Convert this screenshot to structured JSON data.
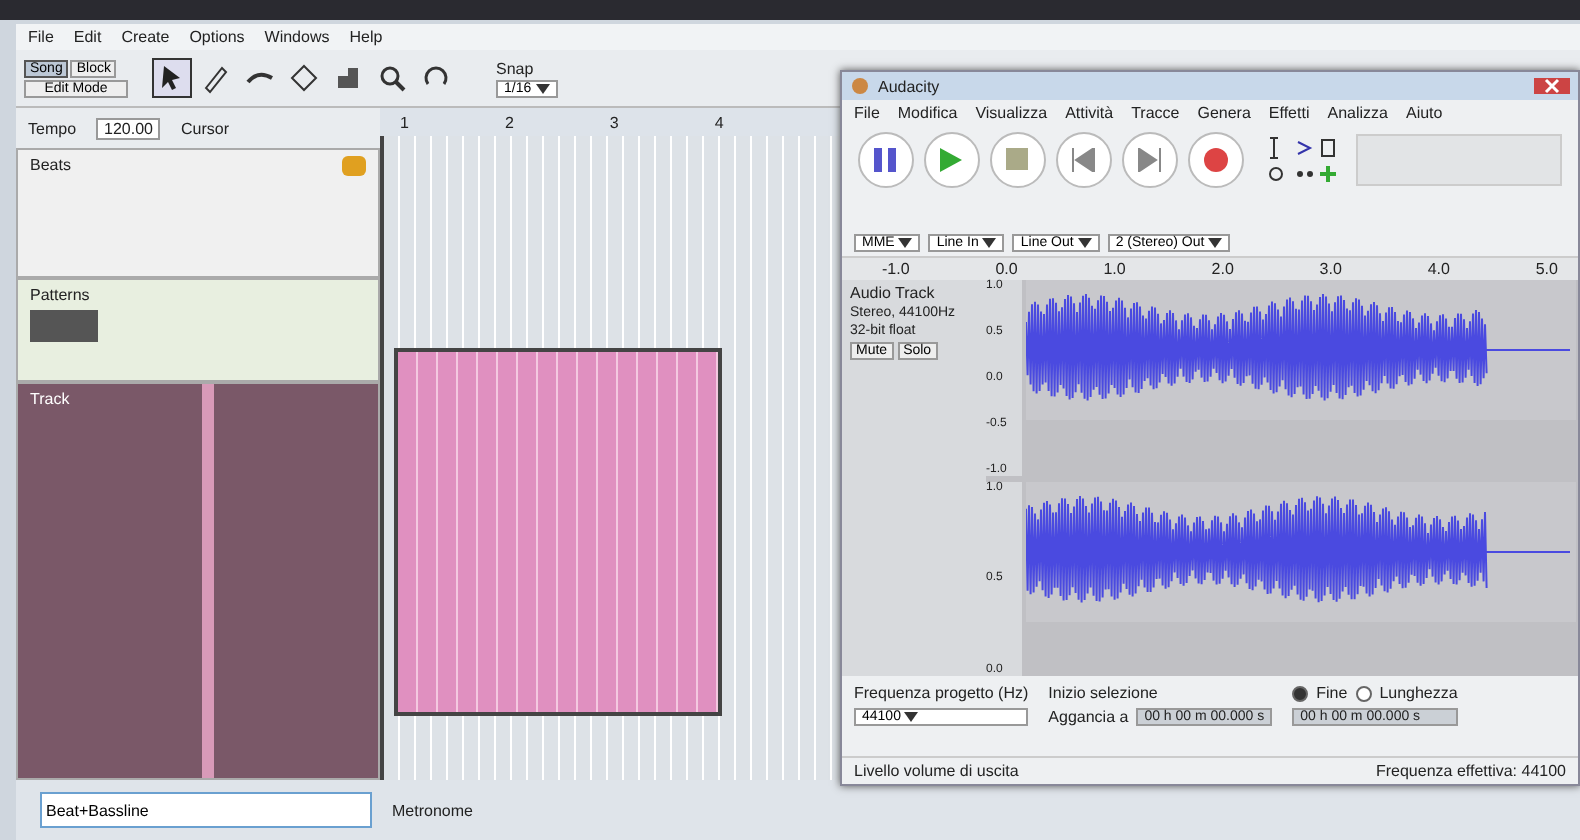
{
  "back_window": {
    "menu": [
      "File",
      "Edit",
      "Create",
      "Options",
      "Windows",
      "Help"
    ],
    "mode_buttons": [
      {
        "label": "Song",
        "selected": true
      },
      {
        "label": "Block",
        "selected": false
      }
    ],
    "edit_mode": "Edit Mode",
    "tools": [
      {
        "kind": "pointer",
        "selected": true
      },
      {
        "kind": "pencil",
        "selected": false
      },
      {
        "kind": "eraser",
        "selected": false
      },
      {
        "kind": "split",
        "selected": false
      },
      {
        "kind": "glue",
        "selected": false
      },
      {
        "kind": "zoom",
        "selected": false
      },
      {
        "kind": "loop",
        "selected": false
      }
    ],
    "snap": {
      "label": "Snap",
      "value": "1/16"
    },
    "tempo": {
      "label": "Tempo",
      "value": "120.00"
    },
    "cursor": {
      "label": "Cursor"
    },
    "timeline_marks": [
      "1",
      "2",
      "3",
      "4"
    ],
    "tracks": [
      {
        "kind": "beat",
        "name": "Beats",
        "color": "#f0f0f0"
      },
      {
        "kind": "sample",
        "name": "Patterns",
        "color": "#e8efe0"
      },
      {
        "kind": "pattern",
        "name": "Track",
        "color": "#7a5868"
      }
    ],
    "input": {
      "value": "Beat+Bassline"
    },
    "bottom_label": "Metronome"
  },
  "audio_window": {
    "title": "Audacity",
    "menu": [
      "File",
      "Modifica",
      "Visualizza",
      "Attività",
      "Tracce",
      "Genera",
      "Effetti",
      "Analizza",
      "Aiuto"
    ],
    "transport": [
      {
        "kind": "pause"
      },
      {
        "kind": "play"
      },
      {
        "kind": "stop"
      },
      {
        "kind": "back"
      },
      {
        "kind": "forward"
      },
      {
        "kind": "record"
      }
    ],
    "devices": [
      "MME",
      "Line In",
      "Line Out",
      "2 (Stereo) Out"
    ],
    "ruler": [
      "-1.0",
      "0.0",
      "1.0",
      "2.0",
      "3.0",
      "4.0",
      "5.0"
    ],
    "track": {
      "name": "Audio Track",
      "info": [
        "Stereo, 44100Hz",
        "32-bit float"
      ],
      "mute": "Mute",
      "solo": "Solo"
    },
    "channels": [
      {
        "scale": [
          "1.0",
          "0.5",
          "0.0",
          "-0.5",
          "-1.0"
        ]
      },
      {
        "scale": [
          "1.0",
          "0.5",
          "0.0"
        ]
      }
    ],
    "selection": {
      "rate_label": "Frequenza progetto (Hz)",
      "rate": "44100",
      "snap_label": "Aggancia a",
      "start_label": "Inizio selezione",
      "end_label": "Fine",
      "end_selected": true,
      "length_selected": false,
      "length_label": "Lunghezza",
      "start": "00 h 00 m 00.000 s",
      "end": "00 h 00 m 00.000 s"
    },
    "status": {
      "left": "Livello volume di uscita",
      "right": "Frequenza effettiva: 44100"
    }
  }
}
